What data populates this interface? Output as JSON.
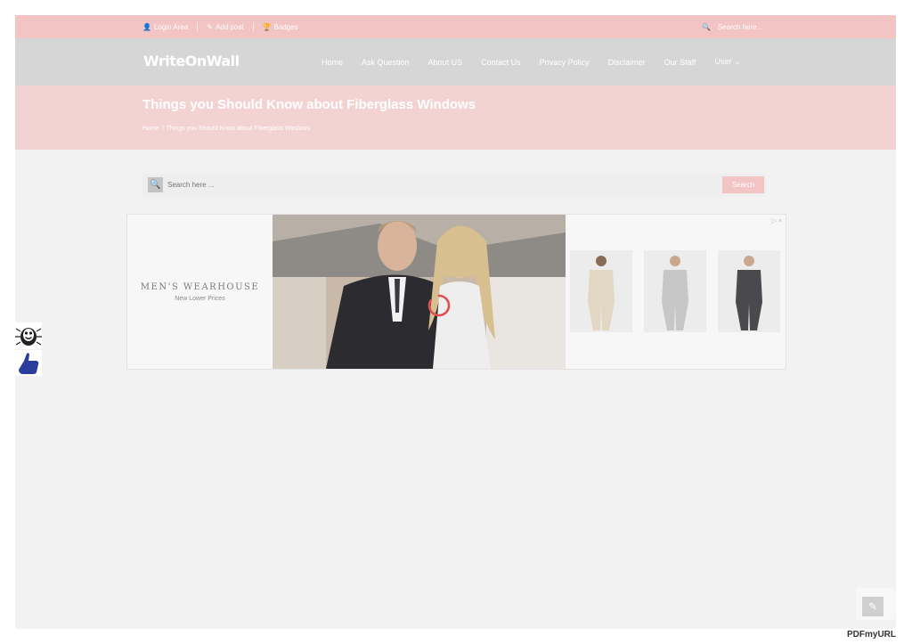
{
  "topbar": {
    "login_label": "Login Area",
    "add_post_label": "Add post",
    "badges_label": "Badges",
    "search_placeholder": "Search here..."
  },
  "header": {
    "logo": "WriteOnWall",
    "nav": [
      {
        "label": "Home"
      },
      {
        "label": "Ask Question"
      },
      {
        "label": "About US"
      },
      {
        "label": "Contact Us"
      },
      {
        "label": "Privacy Policy"
      },
      {
        "label": "Disclaimer"
      },
      {
        "label": "Our Staff"
      },
      {
        "label": "User"
      }
    ]
  },
  "page": {
    "title": "Things you Should Know about Fiberglass Windows",
    "breadcrumb": {
      "home": "Home",
      "separator": "/",
      "current": "Things you Should Know about Fiberglass Windows"
    }
  },
  "search": {
    "placeholder": "Search here ...",
    "button_label": "Search"
  },
  "ad": {
    "brand_name": "MEN'S WEARHOUSE",
    "brand_tagline": "New Lower Prices",
    "choices_icon": "adchoices-icon",
    "close_icon": "close-icon"
  },
  "footer": {
    "pdf_logo": "PDFmyURL"
  },
  "colors": {
    "accent": "#f3c4c4",
    "spinner": "#e05050",
    "header_bg": "#d6d6d6"
  }
}
